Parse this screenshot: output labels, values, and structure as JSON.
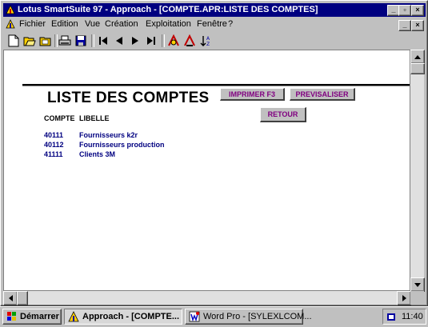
{
  "window": {
    "title": "Lotus SmartSuite 97   -  Approach - [COMPTE.APR:LISTE DES COMPTES]",
    "min_glyph": "_",
    "max_glyph": "▫",
    "close_glyph": "×"
  },
  "menu": {
    "items": [
      {
        "label": "Fichier"
      },
      {
        "label": "Edition"
      },
      {
        "label": "Vue"
      },
      {
        "label": "Création"
      },
      {
        "label": "Exploitation"
      },
      {
        "label": "Fenêtre"
      },
      {
        "label": "?"
      }
    ]
  },
  "toolbar": {
    "icons": [
      "new-document-icon",
      "open-folder-icon",
      "folder-icon",
      "print-icon",
      "save-icon",
      "first-record-icon",
      "previous-record-icon",
      "next-record-icon",
      "last-record-icon",
      "find-icon",
      "find-all-icon",
      "sort-icon"
    ]
  },
  "form": {
    "title": "LISTE DES COMPTES",
    "buttons": {
      "print": "IMPRIMER F3",
      "preview": "PREVISALISER",
      "back": "RETOUR"
    },
    "columns": {
      "account": "COMPTE",
      "label": "LIBELLE"
    },
    "rows": [
      {
        "compte": "40111",
        "libelle": "Fournisseurs k2r"
      },
      {
        "compte": "40112",
        "libelle": "Fournisseurs production"
      },
      {
        "compte": "41111",
        "libelle": "Clients 3M"
      }
    ]
  },
  "taskbar": {
    "start": "Démarrer",
    "tasks": [
      {
        "label": "Approach - [COMPTE..."
      },
      {
        "label": "Word Pro - [SYLEXLCOM..."
      }
    ],
    "clock": "11:40"
  },
  "colors": {
    "titlebar": "#000080",
    "button_text": "#800080",
    "row_text": "#000080"
  }
}
